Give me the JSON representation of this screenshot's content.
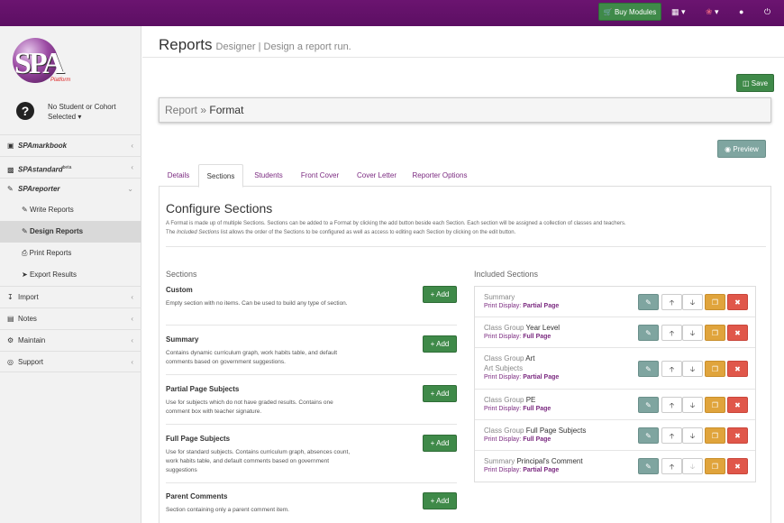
{
  "topbar": {
    "buy_label": "Buy Modules",
    "icons": [
      "cart-icon",
      "table-menu-icon",
      "gift-menu-icon",
      "user-icon",
      "power-icon"
    ]
  },
  "sidebar": {
    "logo_text": "SPA",
    "logo_sub": "Platform",
    "student_label": "No Student or Cohort Selected",
    "items": [
      {
        "label": "SPAmarkbook",
        "icon": "book-icon"
      },
      {
        "label": "SPAstandard",
        "sup": "beta",
        "icon": "chart-icon"
      },
      {
        "label": "SPAreporter",
        "icon": "pencil-square-icon"
      },
      {
        "label": "Write Reports",
        "icon": "pencil-icon"
      },
      {
        "label": "Design Reports",
        "icon": "pencil-icon"
      },
      {
        "label": "Print Reports",
        "icon": "print-icon"
      },
      {
        "label": "Export Results",
        "icon": "send-icon"
      },
      {
        "label": "Import",
        "icon": "download-icon"
      },
      {
        "label": "Notes",
        "icon": "note-icon"
      },
      {
        "label": "Maintain",
        "icon": "cogs-icon"
      },
      {
        "label": "Support",
        "icon": "lifebuoy-icon"
      }
    ]
  },
  "header": {
    "title": "Reports",
    "subtitle": "Designer | Design a report run."
  },
  "save_label": "Save",
  "breadcrumb": {
    "parent": "Report",
    "separator": "»",
    "current": "Format"
  },
  "preview_label": "Preview",
  "tabs": [
    "Details",
    "Sections",
    "Students",
    "Front Cover",
    "Cover Letter",
    "Reporter Options"
  ],
  "configure": {
    "title": "Configure Sections",
    "desc1": "A Format is made up of multiple Sections. Sections can be added to a Format by clicking the add button beside each Section. Each section will be assigned a collection of classes and teachers.",
    "desc2a": "The ",
    "desc2b": "Included Sections",
    "desc2c": " list allows the order of the Sections to be configured as well as access to editing each Section by clicking on the edit button."
  },
  "sections_heading": "Sections",
  "included_heading": "Included Sections",
  "add_label": "Add",
  "sections": [
    {
      "name": "Custom",
      "desc": "Empty section with no items. Can be used to build any type of section."
    },
    {
      "name": "Summary",
      "desc": "Contains dynamic curriculum graph, work habits table, and default comments based on government suggestions."
    },
    {
      "name": "Partial Page Subjects",
      "desc": "Use for subjects which do not have graded results. Contains one comment box with teacher signature."
    },
    {
      "name": "Full Page Subjects",
      "desc": "Use for standard subjects. Contains curriculum graph, absences count, work habits table, and default comments based on government suggestions"
    },
    {
      "name": "Parent Comments",
      "desc": "Section containing only a parent comment item."
    }
  ],
  "print_display_label": "Print Display:",
  "included": [
    {
      "type": "Summary",
      "value": "",
      "line2": "",
      "display": "Partial Page"
    },
    {
      "type": "Class Group",
      "value": "Year Level",
      "line2": "",
      "display": "Full Page"
    },
    {
      "type": "Class Group",
      "value": "Art",
      "line2": "Art Subjects",
      "display": "Partial Page"
    },
    {
      "type": "Class Group",
      "value": "PE",
      "line2": "",
      "display": "Full Page"
    },
    {
      "type": "Class Group",
      "value": "Full Page Subjects",
      "line2": "",
      "display": "Full Page"
    },
    {
      "type": "Summary",
      "value": "Principal's Comment",
      "line2": "",
      "display": "Partial Page"
    }
  ],
  "colors": {
    "brand": "#5c0f63",
    "success": "#3f8a49",
    "info": "#7fa5a0",
    "warning": "#e0a43c",
    "danger": "#e0574a",
    "link": "#7b2a80"
  }
}
